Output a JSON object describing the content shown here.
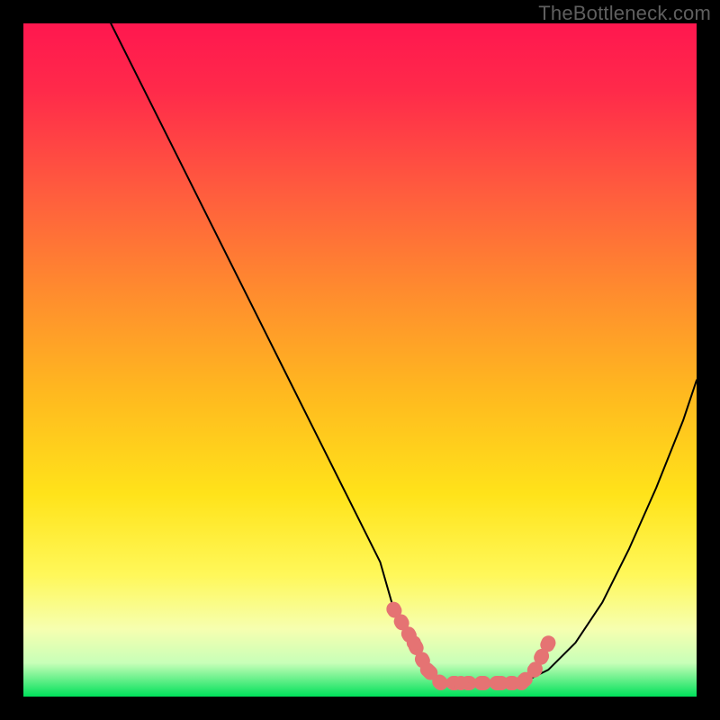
{
  "watermark": "TheBottleneck.com",
  "colors": {
    "frame": "#000000",
    "marker": "#e57373",
    "curve": "#000000",
    "gradient_top": "#ff1744",
    "gradient_mid1": "#ff5252",
    "gradient_mid2": "#ff9800",
    "gradient_mid3": "#ffeb3b",
    "gradient_mid4": "#fff176",
    "gradient_mid5": "#f0f4c3",
    "gradient_bottom": "#00e676"
  },
  "chart_data": {
    "type": "line",
    "title": "",
    "xlabel": "",
    "ylabel": "",
    "xlim": [
      0,
      100
    ],
    "ylim": [
      0,
      100
    ],
    "series": [
      {
        "name": "bottleneck-curve",
        "x": [
          13,
          18,
          23,
          28,
          33,
          38,
          43,
          48,
          53,
          55,
          58,
          60,
          63,
          67,
          70,
          74,
          78,
          82,
          86,
          90,
          94,
          98,
          100
        ],
        "values": [
          100,
          90,
          80,
          70,
          60,
          50,
          40,
          30,
          20,
          13,
          8,
          4,
          2,
          2,
          2,
          2,
          4,
          8,
          14,
          22,
          31,
          41,
          47
        ]
      }
    ],
    "flat_region": {
      "x_start": 55,
      "x_end": 78,
      "y": 2
    },
    "markers": [
      {
        "x": 55,
        "y": 13
      },
      {
        "x": 58,
        "y": 8
      },
      {
        "x": 60,
        "y": 4
      },
      {
        "x": 62,
        "y": 2
      },
      {
        "x": 65,
        "y": 2
      },
      {
        "x": 68,
        "y": 2
      },
      {
        "x": 71,
        "y": 2
      },
      {
        "x": 74,
        "y": 2
      },
      {
        "x": 76,
        "y": 4
      },
      {
        "x": 78,
        "y": 8
      }
    ]
  }
}
